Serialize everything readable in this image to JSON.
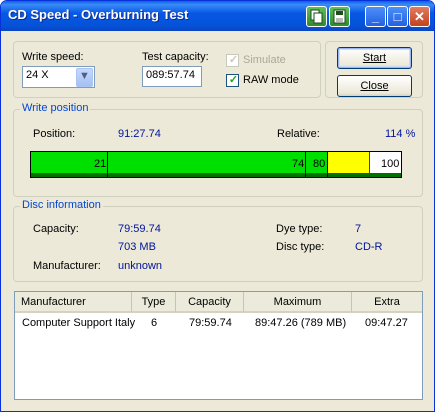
{
  "window": {
    "title": "CD Speed - Overburning Test"
  },
  "titlebar_buttons": {
    "minimize": "_",
    "maximize": "□",
    "close": "✕"
  },
  "settings": {
    "write_speed_label": "Write speed:",
    "write_speed_value": "24 X",
    "test_capacity_label": "Test capacity:",
    "test_capacity_value": "089:57.74",
    "simulate_label": "Simulate",
    "simulate_checked": true,
    "simulate_enabled": false,
    "raw_mode_label": "RAW mode",
    "raw_mode_checked": true
  },
  "buttons": {
    "start": "Start",
    "close": "Close"
  },
  "write_position": {
    "group_title": "Write position",
    "position_label": "Position:",
    "position_value": "91:27.74",
    "relative_label": "Relative:",
    "relative_value": "114 %",
    "bar": {
      "marks": [
        "21",
        "74",
        "80",
        "100"
      ],
      "colors": {
        "green": "#00e000",
        "yellow": "#ffff00",
        "white": "#ffffff",
        "dark_green": "#007000"
      }
    }
  },
  "disc_info": {
    "group_title": "Disc information",
    "capacity_label": "Capacity:",
    "capacity_time": "79:59.74",
    "capacity_size": "703 MB",
    "manufacturer_label": "Manufacturer:",
    "manufacturer_value": "unknown",
    "dye_type_label": "Dye type:",
    "dye_type_value": "7",
    "disc_type_label": "Disc type:",
    "disc_type_value": "CD-R"
  },
  "table": {
    "headers": [
      "Manufacturer",
      "Type",
      "Capacity",
      "Maximum",
      "Extra"
    ],
    "rows": [
      [
        "Computer Support Italy",
        "6",
        "79:59.74",
        "89:47.26 (789 MB)",
        "09:47.27"
      ]
    ]
  }
}
